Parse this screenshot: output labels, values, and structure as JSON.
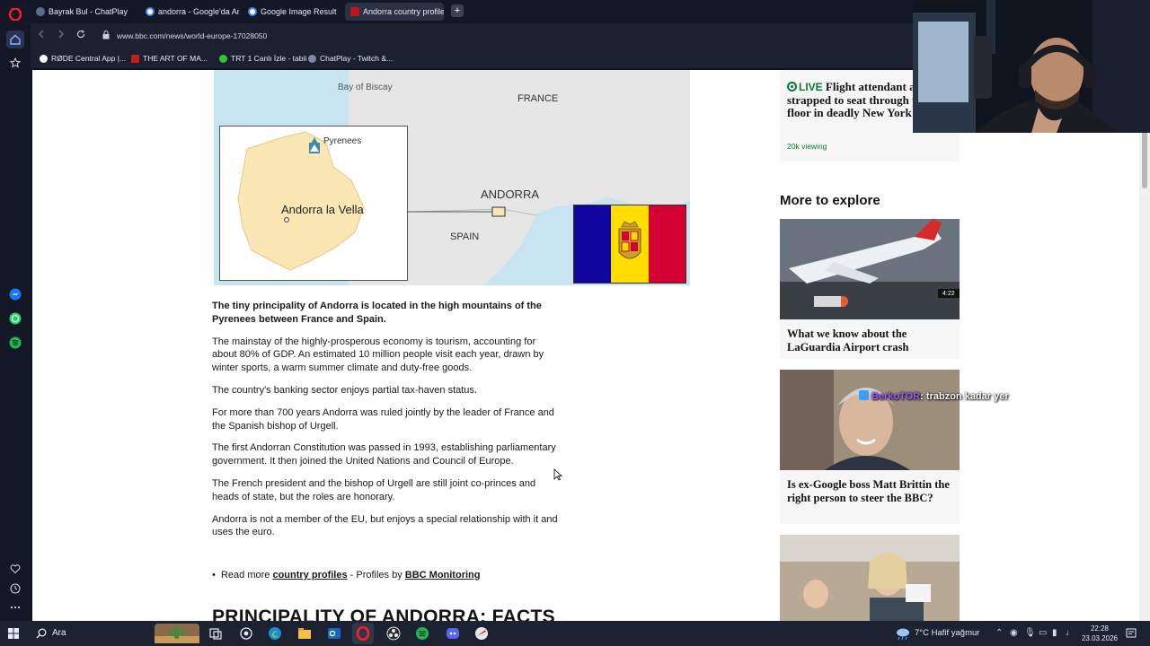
{
  "browser": {
    "tabs": [
      {
        "label": "Bayrak Bul - ChatPlay",
        "active": false
      },
      {
        "label": "andorra - Google'da Ara",
        "active": false
      },
      {
        "label": "Google Image Result",
        "active": false
      },
      {
        "label": "Andorra country profile -",
        "active": true
      }
    ],
    "new_tab_label": "+",
    "url": "www.bbc.com/news/world-europe-17028050",
    "bookmarks": [
      {
        "label": "RØDE Central App |..."
      },
      {
        "label": "THE ART OF MA..."
      },
      {
        "label": "TRT 1 Canlı İzle - tabii"
      },
      {
        "label": "ChatPlay - Twitch &..."
      }
    ]
  },
  "map": {
    "labels": {
      "sea": "Bay of Biscay",
      "france": "FRANCE",
      "pyrenees": "Pyrenees",
      "capital": "Andorra la Vella",
      "andorra": "ANDORRA",
      "spain": "SPAIN"
    }
  },
  "article": {
    "lead": "The tiny principality of Andorra is located in the high mountains of the Pyrenees between France and Spain.",
    "paragraphs": [
      "The mainstay of the highly-prosperous economy is tourism, accounting for about 80% of GDP. An estimated 10 million people visit each year, drawn by winter sports, a warm summer climate and duty-free goods.",
      "The country's banking sector enjoys partial tax-haven status.",
      "For more than 700 years Andorra was ruled jointly by the leader of France and the Spanish bishop of Urgell.",
      "The first Andorran Constitution was passed in 1993, establishing parliamentary government. It then joined the United Nations and Council of Europe.",
      "The French president and the bishop of Urgell are still joint co-princes and heads of state, but the roles are honorary.",
      "Andorra is not a member of the EU, but enjoys a special relationship with it and uses the euro."
    ],
    "readmore": {
      "prefix": "Read more ",
      "link1": "country profiles",
      "middle": " - Profiles by ",
      "link2": "BBC Monitoring"
    },
    "facts_heading": "PRINCIPALITY OF ANDORRA: FACTS"
  },
  "sidebar": {
    "live": {
      "badge": "LIVE",
      "headline": "Flight attendant alive strapped to seat through plane floor in deadly New York crash",
      "viewing": "20k viewing"
    },
    "more_heading": "More to explore",
    "stories": [
      {
        "headline": "What we know about the LaGuardia Airport crash",
        "badge": "4:22"
      },
      {
        "headline": "Is ex-Google boss Matt Brittin the right person to steer the BBC?"
      },
      {
        "headline": ""
      }
    ]
  },
  "chat_overlay": {
    "user": "BerkoTOR",
    "message": ": trabzon kadar yer"
  },
  "taskbar": {
    "search_label": "Ara",
    "weather": "7°C  Hafif yağmur",
    "time": "22:28",
    "date": "23.03.2026"
  },
  "colors": {
    "flag_blue": "#10069f",
    "flag_yellow": "#fedd00",
    "flag_red": "#d50032",
    "bbc_live_green": "#0b7a37",
    "chat_user": "#9b5cff"
  }
}
